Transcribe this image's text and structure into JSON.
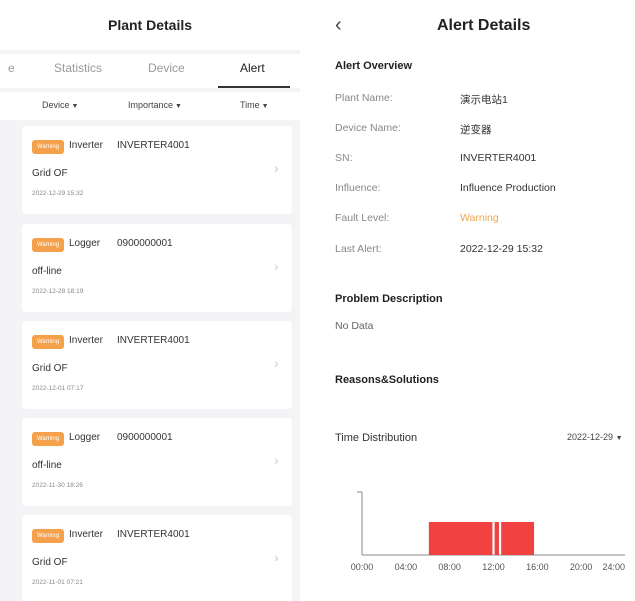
{
  "left": {
    "title": "Plant Details",
    "tabs": [
      {
        "label": "e"
      },
      {
        "label": "Statistics"
      },
      {
        "label": "Device"
      },
      {
        "label": "Alert"
      }
    ],
    "filters": [
      {
        "label": "Device"
      },
      {
        "label": "Importance"
      },
      {
        "label": "Time"
      }
    ],
    "alerts": [
      {
        "badge": "Warning",
        "type": "Inverter",
        "code": "INVERTER4001",
        "message": "Grid OF",
        "time": "2022-12-29 15:32"
      },
      {
        "badge": "Warning",
        "type": "Logger",
        "code": "0900000001",
        "message": "off-line",
        "time": "2022-12-28 18:19"
      },
      {
        "badge": "Warning",
        "type": "Inverter",
        "code": "INVERTER4001",
        "message": "Grid OF",
        "time": "2022-12-01 07:17"
      },
      {
        "badge": "Warning",
        "type": "Logger",
        "code": "0900000001",
        "message": "off-line",
        "time": "2022-11-30 18:26"
      },
      {
        "badge": "Warning",
        "type": "Inverter",
        "code": "INVERTER4001",
        "message": "Grid OF",
        "time": "2022-11-01 07:21"
      }
    ]
  },
  "right": {
    "back_icon": "chevron-left-icon",
    "title": "Alert Details",
    "overview": {
      "title": "Alert Overview",
      "rows": [
        {
          "label": "Plant Name:",
          "value": "演示电站1"
        },
        {
          "label": "Device Name:",
          "value": "逆变器"
        },
        {
          "label": "SN:",
          "value": "INVERTER4001"
        },
        {
          "label": "Influence:",
          "value": "Influence Production"
        },
        {
          "label": "Fault Level:",
          "value": "Warning"
        },
        {
          "label": "Last Alert:",
          "value": "2022-12-29 15:32"
        }
      ]
    },
    "problem": {
      "title": "Problem Description",
      "value": "No Data"
    },
    "reasons": {
      "title": "Reasons&Solutions"
    },
    "time_distribution": {
      "label": "Time Distribution",
      "date": "2022-12-29"
    }
  },
  "colors": {
    "warning": "#f5a04b",
    "bar": "#f24141"
  },
  "chart_data": {
    "type": "bar",
    "x_ticks": [
      "00:00",
      "04:00",
      "08:00",
      "12:00",
      "16:00",
      "20:00",
      "24:00"
    ],
    "xlim": [
      0,
      24
    ],
    "intervals": [
      {
        "start": 6.1,
        "end": 11.9
      },
      {
        "start": 12.1,
        "end": 12.5
      },
      {
        "start": 12.7,
        "end": 15.7
      }
    ]
  }
}
